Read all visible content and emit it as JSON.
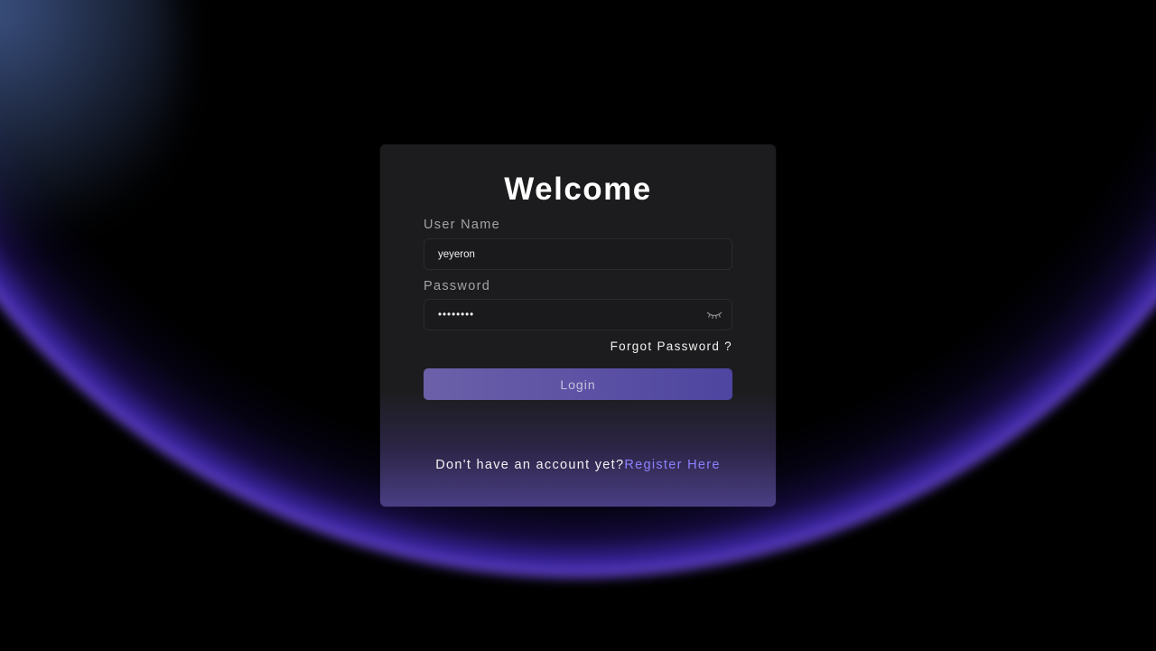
{
  "login": {
    "title": "Welcome",
    "username_label": "User Name",
    "username_value": "yeyeron",
    "password_label": "Password",
    "password_value": "yeyeron1",
    "forgot_label": "Forgot Password ?",
    "login_label": "Login",
    "footer_text": "Don't have an account yet?",
    "register_label": "Register Here",
    "password_toggle_icon": "eye-closed-icon"
  },
  "colors": {
    "background": "#000000",
    "card": "#1c1c1e",
    "accent": "#8d80ff",
    "button": "#5d52a4",
    "glow": "#a070f0"
  }
}
